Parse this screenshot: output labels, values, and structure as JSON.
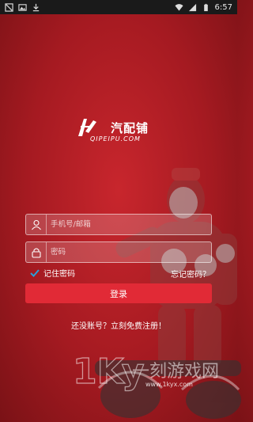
{
  "status_bar": {
    "time": "6:57",
    "left_icons": [
      "notification-icon",
      "image-icon",
      "download-icon"
    ],
    "right_icons": [
      "wifi-icon",
      "signal-icon",
      "battery-icon"
    ]
  },
  "logo": {
    "brand_text": "汽配铺",
    "sub_text": "QIPEIPU.COM"
  },
  "login_form": {
    "phone_placeholder": "手机号/邮箱",
    "password_placeholder": "密码",
    "remember_label": "记住密码",
    "remember_checked": true,
    "forgot_label": "忘记密码？",
    "login_button": "登录",
    "register_text": "还没账号？立刻免费注册！"
  },
  "colors": {
    "background": "#b31e25",
    "button": "#e12a36"
  },
  "watermark": {
    "text": "一刻游戏网",
    "url": "www.1kyx.com"
  }
}
